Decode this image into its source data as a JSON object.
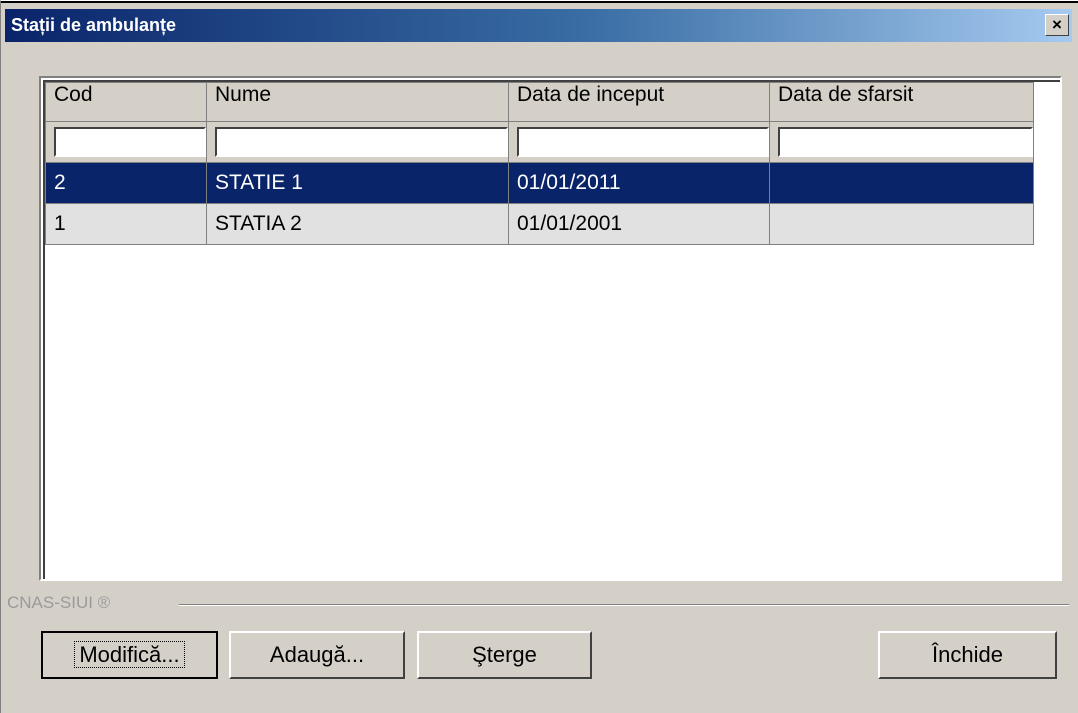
{
  "window": {
    "title": "Stații de ambulanțe",
    "close_label": "×"
  },
  "grid": {
    "columns": [
      "Cod",
      "Nume",
      "Data de inceput",
      "Data de sfarsit"
    ],
    "filters": [
      "",
      "",
      "",
      ""
    ],
    "rows": [
      {
        "cod": "2",
        "nume": "STATIE 1",
        "data_inceput": "01/01/2011",
        "data_sfarsit": "",
        "selected": true
      },
      {
        "cod": "1",
        "nume": "STATIA 2",
        "data_inceput": "01/01/2001",
        "data_sfarsit": "",
        "selected": false
      }
    ]
  },
  "footer": {
    "group_label": "CNAS-SIUI ®"
  },
  "buttons": {
    "modify": "Modifică...",
    "add": "Adaugă...",
    "delete": "Şterge",
    "close": "Închide"
  },
  "colors": {
    "title_start": "#0a246a",
    "title_end": "#a6caf0",
    "selection": "#0a246a",
    "face": "#d4d0c8"
  }
}
